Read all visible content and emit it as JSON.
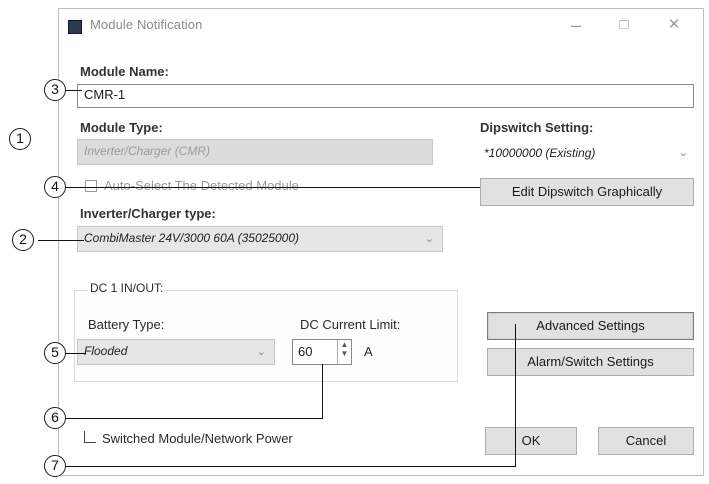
{
  "window": {
    "title": "Module Notification",
    "min_glyph": "–",
    "max_glyph": "□",
    "close_glyph": "✕"
  },
  "module_name": {
    "label": "Module Name:",
    "value": "CMR-1"
  },
  "module_type": {
    "label": "Module Type:",
    "value": "Inverter/Charger (CMR)"
  },
  "auto_select": {
    "label": "Auto-Select The Detected Module"
  },
  "dipswitch": {
    "label": "Dipswitch Setting:",
    "value": "*10000000 (Existing)",
    "edit_button": "Edit Dipswitch Graphically"
  },
  "inverter_type": {
    "label": "Inverter/Charger type:",
    "value": "CombiMaster 24V/3000   60A   (35025000)"
  },
  "dc_group": {
    "title": "DC 1 IN/OUT:",
    "battery_type_label": "Battery Type:",
    "battery_type_value": "Flooded",
    "dc_limit_label": "DC Current Limit:",
    "dc_limit_value": "60",
    "dc_limit_unit": "A"
  },
  "buttons": {
    "advanced": "Advanced Settings",
    "alarm": "Alarm/Switch Settings",
    "ok": "OK",
    "cancel": "Cancel"
  },
  "switched_power": {
    "label": "Switched Module/Network Power",
    "checked": false
  },
  "callouts": [
    "1",
    "2",
    "3",
    "4",
    "5",
    "6",
    "7"
  ],
  "dropdown_glyph": "⌄"
}
